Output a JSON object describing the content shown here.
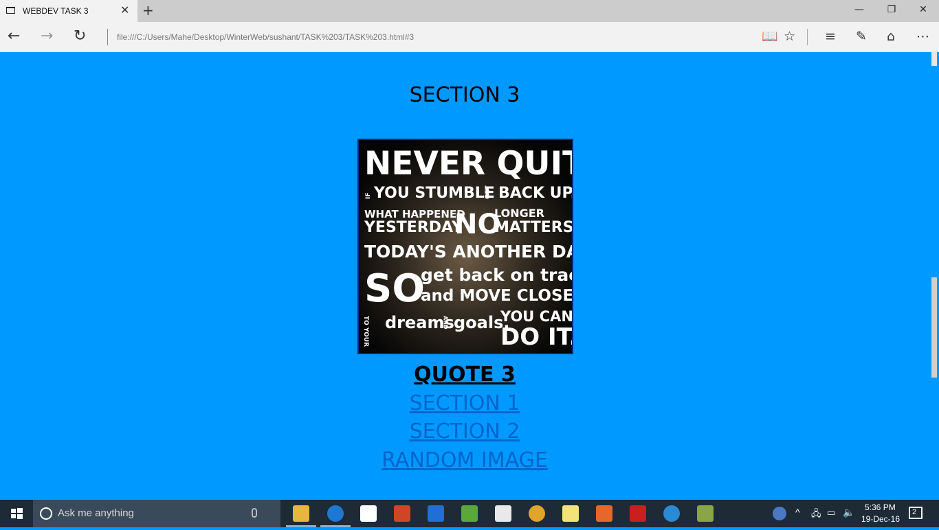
{
  "browser": {
    "tab_title": "WEBDEV TASK 3",
    "new_tab_symbol": "+",
    "address": "file:///C:/Users/Mahe/Desktop/WinterWeb/sushant/TASK%203/TASK%203.html#3"
  },
  "page": {
    "section_title": "SECTION 3",
    "quote_label": "QUOTE 3",
    "links": [
      "SECTION 1",
      "SECTION 2",
      "RANDOM IMAGE"
    ],
    "background_color": "#0099ff",
    "link_color": "#0066cc"
  },
  "poster": {
    "line1": "NEVER QUIT.",
    "if": "IF",
    "you_stumble": "YOU STUMBLE",
    "get": "GET",
    "back_up": "BACK UP.",
    "what_happened": "WHAT HAPPENED",
    "yesterday": "YESTERDAY",
    "no": "NO",
    "longer": "LONGER",
    "matters": "MATTERS.",
    "todays": "TODAY'S ANOTHER DAY",
    "so": "SO",
    "get_back": "get back on track",
    "and_move": "and MOVE CLOSER",
    "to_your": "TO YOUR",
    "dreams": "dreams",
    "and": "AND",
    "goals": "goals.",
    "you_can": "YOU CAN",
    "do_it": "DO IT."
  },
  "taskbar": {
    "search_placeholder": "Ask me anything",
    "time": "5:36 PM",
    "date": "19-Dec-16",
    "notification_count": "2"
  }
}
